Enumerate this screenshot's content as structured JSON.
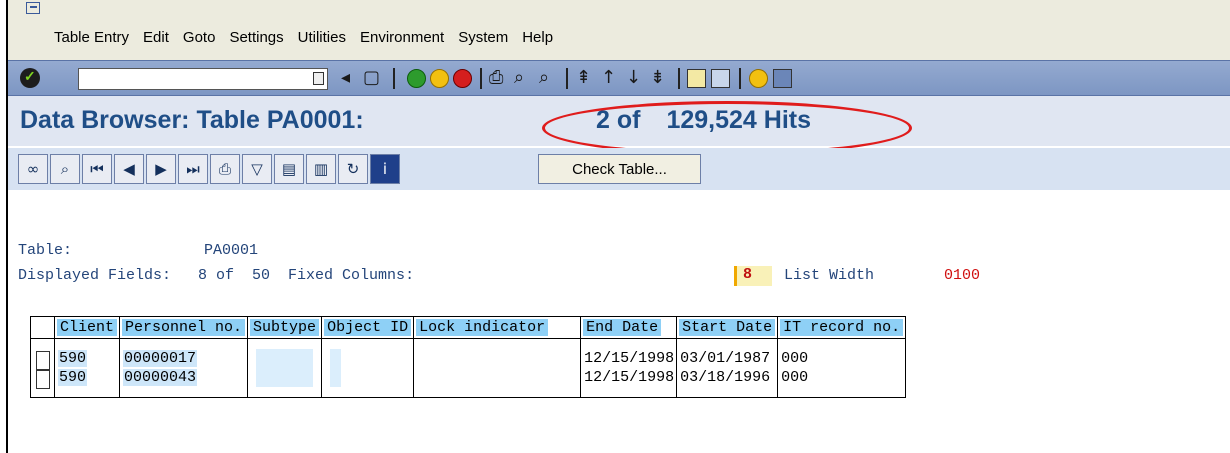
{
  "menubar": {
    "items": [
      "Table Entry",
      "Edit",
      "Goto",
      "Settings",
      "Utilities",
      "Environment",
      "System",
      "Help"
    ]
  },
  "toolbar": {
    "command_field": {
      "value": "",
      "placeholder": ""
    },
    "icons": [
      "enter-icon",
      "dropdown-icon",
      "back-arrow-icon",
      "save-icon",
      "back-icon",
      "exit-icon",
      "cancel-icon",
      "print-icon",
      "find-icon",
      "find-next-icon",
      "first-page-icon",
      "previous-page-icon",
      "next-page-icon",
      "last-page-icon",
      "create-session-icon",
      "shortcut-icon",
      "help-icon",
      "layout-icon"
    ]
  },
  "title": {
    "text": "Data Browser: Table PA0001:",
    "hits_count": "2 of",
    "hits_total": "129,524 Hits"
  },
  "app_toolbar": {
    "icons": [
      "glasses-icon",
      "magnifier-icon",
      "first-icon",
      "previous-icon",
      "next-icon",
      "last-icon",
      "print-icon",
      "filter-icon",
      "select-all-icon",
      "deselect-icon",
      "refresh-icon",
      "info-icon"
    ],
    "check_table_label": "Check Table..."
  },
  "info": {
    "table_label": "Table:",
    "table_value": "PA0001",
    "displayed_fields": "Displayed Fields:   8 of  50  Fixed Columns:",
    "fixed_columns_value": "8",
    "list_width_label": "List Width",
    "list_width_value": "0100"
  },
  "table": {
    "columns": [
      "Client",
      "Personnel no.",
      "Subtype",
      "Object ID",
      "Lock indicator",
      "End Date",
      "Start Date",
      "IT record no."
    ],
    "rows": [
      {
        "client": "590",
        "personnel_no": "00000017",
        "subtype": "",
        "object_id": "",
        "lock_indicator": "",
        "end_date": "12/15/1998",
        "start_date": "03/01/1987",
        "it_record_no": "000"
      },
      {
        "client": "590",
        "personnel_no": "00000043",
        "subtype": "",
        "object_id": "",
        "lock_indicator": "",
        "end_date": "12/15/1998",
        "start_date": "03/18/1996",
        "it_record_no": "000"
      }
    ]
  },
  "colors": {
    "title_blue": "#1f4e87",
    "highlight_oval": "#e01c1c",
    "header_cell": "#8ed0f6",
    "list_width_red": "#d01010"
  }
}
